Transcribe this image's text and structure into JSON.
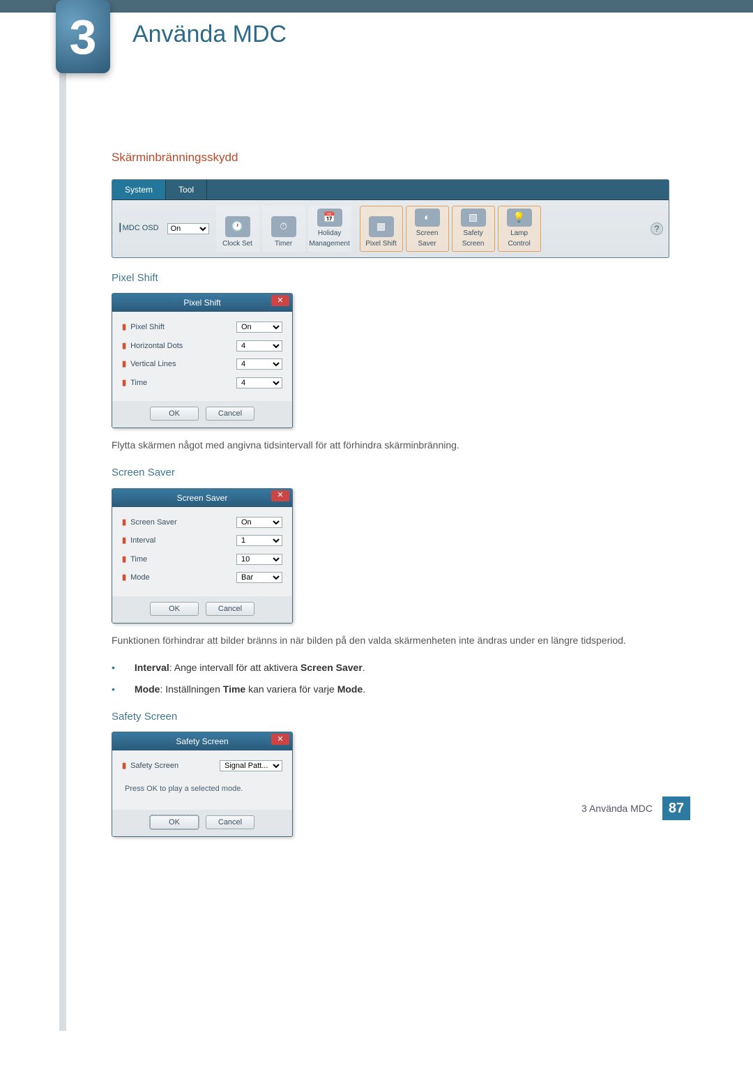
{
  "chapter": {
    "number": "3",
    "title": "Använda MDC"
  },
  "section_title": "Skärminbränningsskydd",
  "system_panel": {
    "tabs": {
      "system": "System",
      "tool": "Tool"
    },
    "osd_label": "┃MDC OSD",
    "osd_value": "On",
    "items": [
      {
        "label": "Clock Set",
        "icon": "clock-icon"
      },
      {
        "label": "Timer",
        "icon": "timer-icon"
      },
      {
        "label": "Holiday Management",
        "icon": "holiday-icon"
      },
      {
        "label": "Pixel Shift",
        "icon": "pixel-shift-icon"
      },
      {
        "label": "Screen Saver",
        "icon": "screen-saver-icon"
      },
      {
        "label": "Safety Screen",
        "icon": "safety-screen-icon"
      },
      {
        "label": "Lamp Control",
        "icon": "lamp-icon"
      }
    ],
    "highlight_start": 3,
    "help": "?"
  },
  "pixel_shift": {
    "heading": "Pixel Shift",
    "dialog_title": "Pixel Shift",
    "rows": [
      {
        "label": "Pixel Shift",
        "value": "On"
      },
      {
        "label": "Horizontal Dots",
        "value": "4"
      },
      {
        "label": "Vertical Lines",
        "value": "4"
      },
      {
        "label": "Time",
        "value": "4"
      }
    ],
    "ok": "OK",
    "cancel": "Cancel",
    "description": "Flytta skärmen något med angivna tidsintervall för att förhindra skärminbränning."
  },
  "screen_saver": {
    "heading": "Screen Saver",
    "dialog_title": "Screen Saver",
    "rows": [
      {
        "label": "Screen Saver",
        "value": "On"
      },
      {
        "label": "Interval",
        "value": "1"
      },
      {
        "label": "Time",
        "value": "10"
      },
      {
        "label": "Mode",
        "value": "Bar"
      }
    ],
    "ok": "OK",
    "cancel": "Cancel",
    "description": "Funktionen förhindrar att bilder bränns in när bilden på den valda skärmenheten inte ändras under en längre tidsperiod.",
    "bullets": [
      {
        "bold1": "Interval",
        "mid": ": Ange intervall för att aktivera ",
        "bold2": "Screen Saver",
        "tail": "."
      },
      {
        "bold1": "Mode",
        "mid": ": Inställningen ",
        "bold2": "Time",
        "mid2": " kan variera för varje ",
        "bold3": "Mode",
        "tail": "."
      }
    ]
  },
  "safety_screen": {
    "heading": "Safety Screen",
    "dialog_title": "Safety Screen",
    "row_label": "Safety Screen",
    "row_value": "Signal Patt...",
    "message": "Press OK to play a selected mode.",
    "ok": "OK",
    "cancel": "Cancel"
  },
  "footer": {
    "text": "3 Använda MDC",
    "page": "87"
  }
}
